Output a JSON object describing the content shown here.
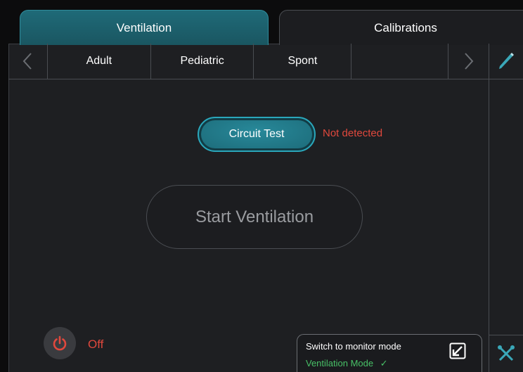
{
  "tabs": {
    "ventilation": "Ventilation",
    "calibrations": "Calibrations"
  },
  "modes": [
    "Adult",
    "Pediatric",
    "Spont",
    ""
  ],
  "nav": {
    "prev": "‹",
    "next": "›"
  },
  "circuit_test": {
    "label": "Circuit Test",
    "status": "Not detected",
    "status_color": "#e0483d"
  },
  "start_ventilation": "Start Ventilation",
  "power": {
    "label": "Off",
    "color": "#e0483d",
    "icon": "power-icon"
  },
  "monitor_mode": {
    "title": "Switch to monitor mode",
    "subtitle": "Ventilation Mode",
    "check": "✓",
    "icon": "arrow-down-left-icon"
  },
  "side": {
    "edit_icon": "pencil-icon",
    "tools_icon": "tools-icon"
  },
  "colors": {
    "accent": "#1f6a78",
    "alert": "#e0483d",
    "ok": "#48c067"
  }
}
